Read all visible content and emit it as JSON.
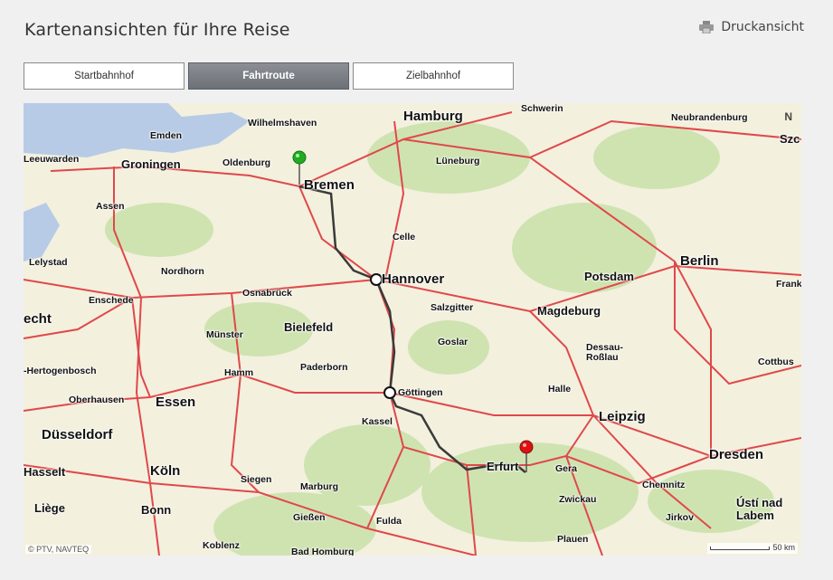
{
  "page": {
    "title": "Kartenansichten für Ihre Reise",
    "print_label": "Druckansicht"
  },
  "tabs": [
    {
      "label": "Startbahnhof",
      "active": false
    },
    {
      "label": "Fahrtroute",
      "active": true
    },
    {
      "label": "Zielbahnhof",
      "active": false
    }
  ],
  "map": {
    "north_label": "N",
    "copyright": "© PTV, NAVTEQ",
    "scale_label": "50 km",
    "cities": [
      {
        "name": "Hamburg",
        "size": "big"
      },
      {
        "name": "Schwerin",
        "size": "sm"
      },
      {
        "name": "Wilhelmshaven",
        "size": "sm"
      },
      {
        "name": "Neubrandenburg",
        "size": "sm"
      },
      {
        "name": "Szc",
        "size": "mid"
      },
      {
        "name": "Emden",
        "size": "sm"
      },
      {
        "name": "Leeuwarden",
        "size": "sm"
      },
      {
        "name": "Groningen",
        "size": "mid"
      },
      {
        "name": "Oldenburg",
        "size": "sm"
      },
      {
        "name": "Lüneburg",
        "size": "sm"
      },
      {
        "name": "Bremen",
        "size": "big"
      },
      {
        "name": "Assen",
        "size": "sm"
      },
      {
        "name": "Celle",
        "size": "sm"
      },
      {
        "name": "Lelystad",
        "size": "sm"
      },
      {
        "name": "Nordhorn",
        "size": "sm"
      },
      {
        "name": "Berlin",
        "size": "big"
      },
      {
        "name": "Potsdam",
        "size": "mid"
      },
      {
        "name": "Enschede",
        "size": "sm"
      },
      {
        "name": "Osnabrück",
        "size": "sm"
      },
      {
        "name": "Hannover",
        "size": "big"
      },
      {
        "name": "Frank",
        "size": "sm"
      },
      {
        "name": "echt",
        "size": "big"
      },
      {
        "name": "Salzgitter",
        "size": "sm"
      },
      {
        "name": "Magdeburg",
        "size": "mid"
      },
      {
        "name": "Bielefeld",
        "size": "mid"
      },
      {
        "name": "Münster",
        "size": "sm"
      },
      {
        "name": "Goslar",
        "size": "sm"
      },
      {
        "name": "Dessau-",
        "size": "sm"
      },
      {
        "name": "Roßlau",
        "size": "sm"
      },
      {
        "name": "-Hertogenbosch",
        "size": "sm"
      },
      {
        "name": "Hamm",
        "size": "sm"
      },
      {
        "name": "Paderborn",
        "size": "sm"
      },
      {
        "name": "Cottbus",
        "size": "sm"
      },
      {
        "name": "Oberhausen",
        "size": "sm"
      },
      {
        "name": "Essen",
        "size": "big"
      },
      {
        "name": "Göttingen",
        "size": "sm"
      },
      {
        "name": "Halle",
        "size": "sm"
      },
      {
        "name": "Kassel",
        "size": "sm"
      },
      {
        "name": "Leipzig",
        "size": "big"
      },
      {
        "name": "Düsseldorf",
        "size": "big"
      },
      {
        "name": "Dresden",
        "size": "big"
      },
      {
        "name": "Erfurt",
        "size": "mid"
      },
      {
        "name": "Hasselt",
        "size": "mid"
      },
      {
        "name": "Köln",
        "size": "big"
      },
      {
        "name": "Siegen",
        "size": "sm"
      },
      {
        "name": "Gera",
        "size": "sm"
      },
      {
        "name": "Chemnitz",
        "size": "sm"
      },
      {
        "name": "Marburg",
        "size": "sm"
      },
      {
        "name": "Liège",
        "size": "mid"
      },
      {
        "name": "Zwickau",
        "size": "sm"
      },
      {
        "name": "Ústí nad",
        "size": "mid"
      },
      {
        "name": "Labem",
        "size": "mid"
      },
      {
        "name": "Bonn",
        "size": "mid"
      },
      {
        "name": "Gießen",
        "size": "sm"
      },
      {
        "name": "Fulda",
        "size": "sm"
      },
      {
        "name": "Jirkov",
        "size": "sm"
      },
      {
        "name": "Plauen",
        "size": "sm"
      },
      {
        "name": "Koblenz",
        "size": "sm"
      },
      {
        "name": "Bad Homburg",
        "size": "sm"
      }
    ],
    "route": {
      "start": "Bremen",
      "via": [
        "Hannover",
        "Göttingen"
      ],
      "end": "Erfurt"
    },
    "colors": {
      "start_pin": "#22aa22",
      "end_pin": "#dd1111",
      "route": "#3a3a3a",
      "road": "#e0484a",
      "water": "#b7cbe6",
      "forest": "#cfe3b1"
    }
  }
}
